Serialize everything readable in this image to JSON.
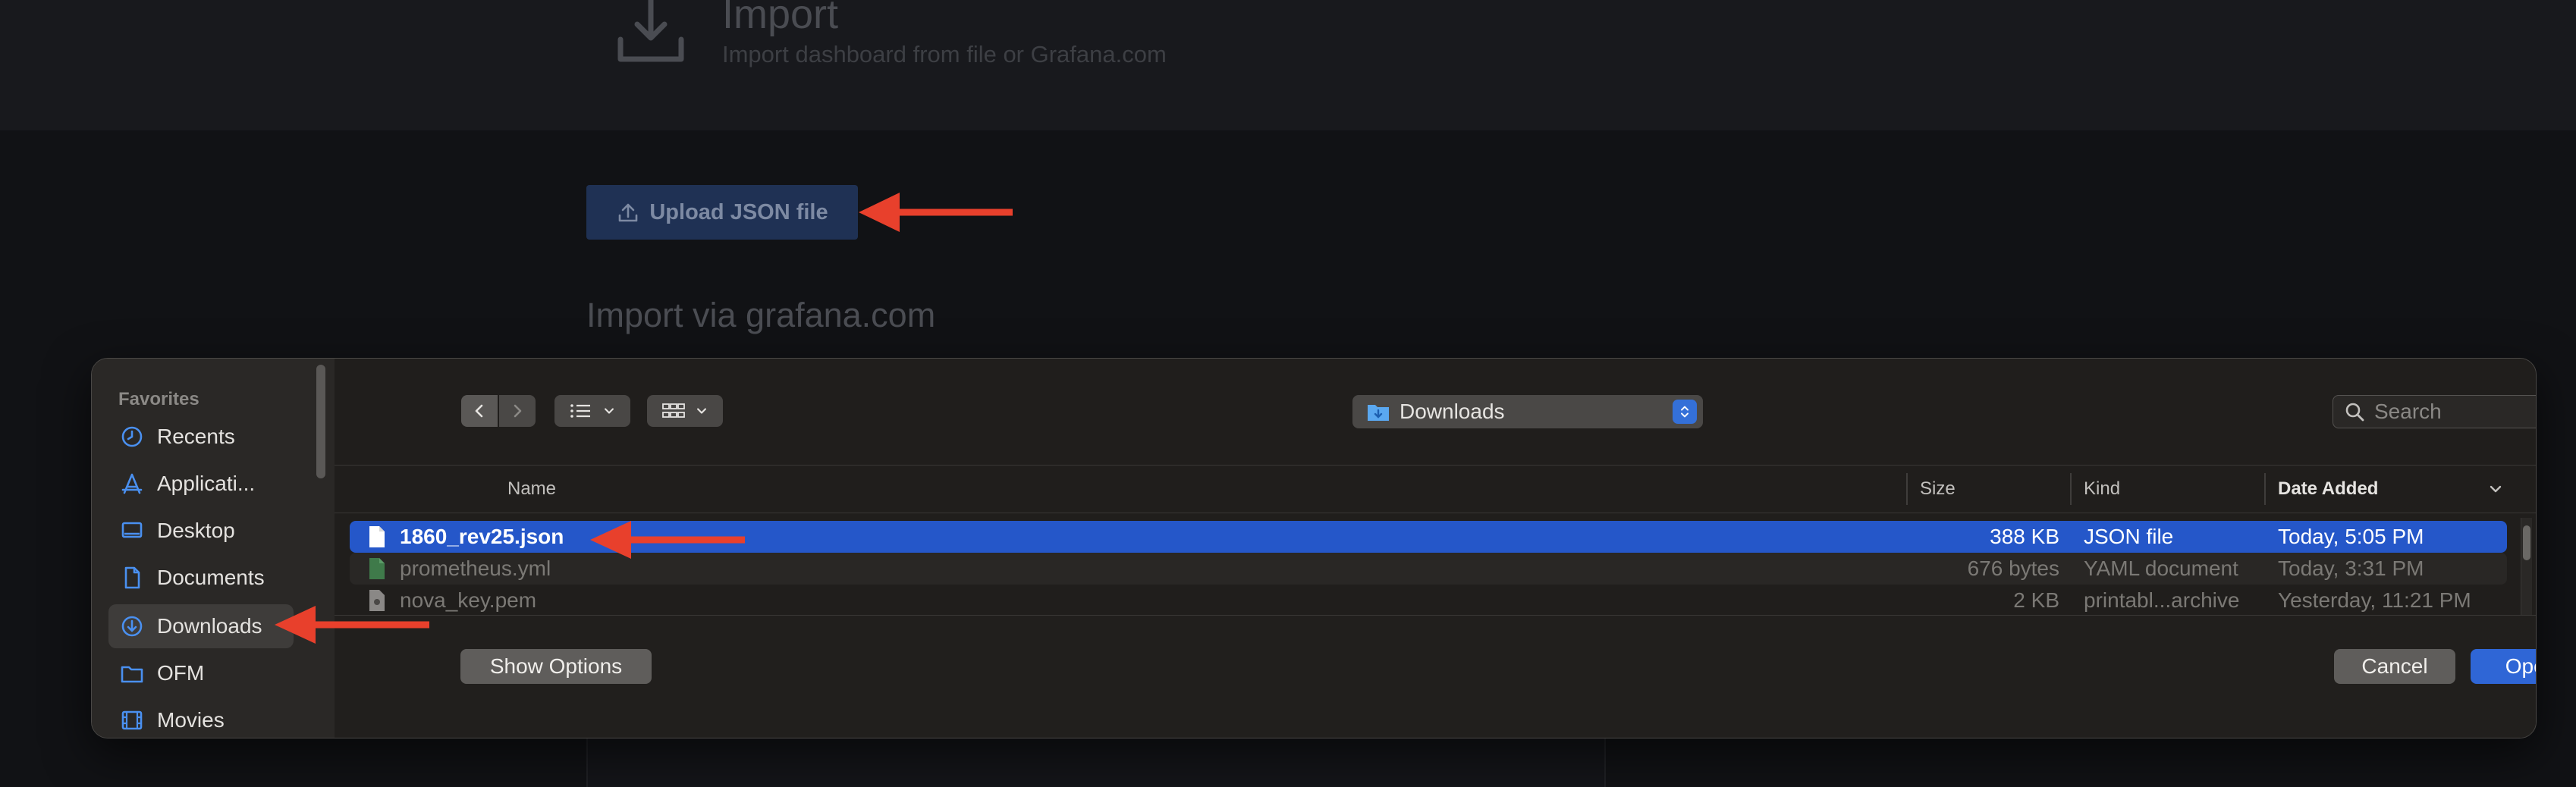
{
  "background": {
    "title": "Import",
    "subtitle": "Import dashboard from file or Grafana.com",
    "upload_button_label": "Upload JSON file",
    "import_via_heading": "Import via grafana.com"
  },
  "dialog": {
    "sidebar": {
      "heading": "Favorites",
      "items": [
        {
          "label": "Recents",
          "icon": "clock-icon"
        },
        {
          "label": "Applicati...",
          "icon": "applications-icon"
        },
        {
          "label": "Desktop",
          "icon": "desktop-icon"
        },
        {
          "label": "Documents",
          "icon": "document-icon"
        },
        {
          "label": "Downloads",
          "icon": "download-circle-icon",
          "selected": true
        },
        {
          "label": "OFM",
          "icon": "folder-icon"
        },
        {
          "label": "Movies",
          "icon": "film-icon"
        }
      ]
    },
    "toolbar": {
      "location": "Downloads",
      "search_placeholder": "Search"
    },
    "columns": {
      "name": "Name",
      "size": "Size",
      "kind": "Kind",
      "date_added": "Date Added"
    },
    "files": [
      {
        "name": "1860_rev25.json",
        "size": "388 KB",
        "kind": "JSON file",
        "date": "Today, 5:05 PM",
        "selected": true
      },
      {
        "name": "prometheus.yml",
        "size": "676 bytes",
        "kind": "YAML document",
        "date": "Today, 3:31 PM"
      },
      {
        "name": "nova_key.pem",
        "size": "2 KB",
        "kind": "printabl...archive",
        "date": "Yesterday, 11:21 PM"
      }
    ],
    "buttons": {
      "show_options": "Show Options",
      "cancel": "Cancel",
      "open": "Open"
    }
  },
  "colors": {
    "selection": "#2557c9",
    "annotation_arrow": "#e8402c",
    "primary_button": "#2f66d6"
  }
}
